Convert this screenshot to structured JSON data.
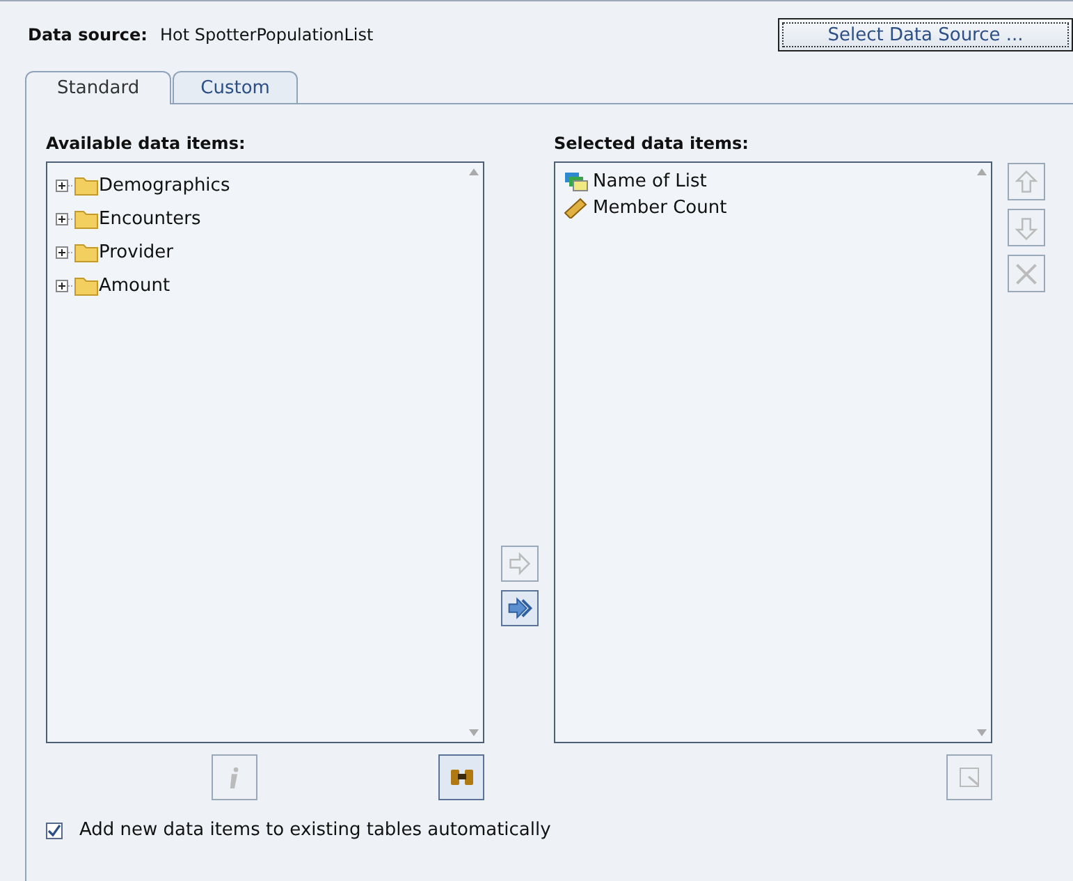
{
  "data_source": {
    "label": "Data source:",
    "value": "Hot SpotterPopulationList",
    "button": "Select Data Source ..."
  },
  "tabs": [
    {
      "label": "Standard",
      "selected": true
    },
    {
      "label": "Custom",
      "selected": false
    }
  ],
  "available": {
    "label": "Available data items:",
    "items": [
      {
        "label": "Demographics",
        "expanded": false
      },
      {
        "label": "Encounters",
        "expanded": false
      },
      {
        "label": "Provider",
        "expanded": false
      },
      {
        "label": "Amount",
        "expanded": false
      }
    ],
    "buttons": [
      {
        "kind": "info",
        "disabled": true
      },
      {
        "kind": "find",
        "disabled": false
      }
    ]
  },
  "move_buttons": [
    {
      "kind": "add",
      "disabled": true
    },
    {
      "kind": "add_all",
      "disabled": false
    }
  ],
  "selected": {
    "label": "Selected data items:",
    "items": [
      {
        "label": "Name of List",
        "kind": "category"
      },
      {
        "label": "Member Count",
        "kind": "measure"
      }
    ],
    "side_buttons": [
      {
        "kind": "up",
        "disabled": true
      },
      {
        "kind": "down",
        "disabled": true
      },
      {
        "kind": "remove",
        "disabled": true
      }
    ],
    "buttons": [
      {
        "kind": "properties",
        "disabled": true
      }
    ]
  },
  "auto_add": {
    "label": "Add new data items to existing tables automatically",
    "checked": true
  }
}
